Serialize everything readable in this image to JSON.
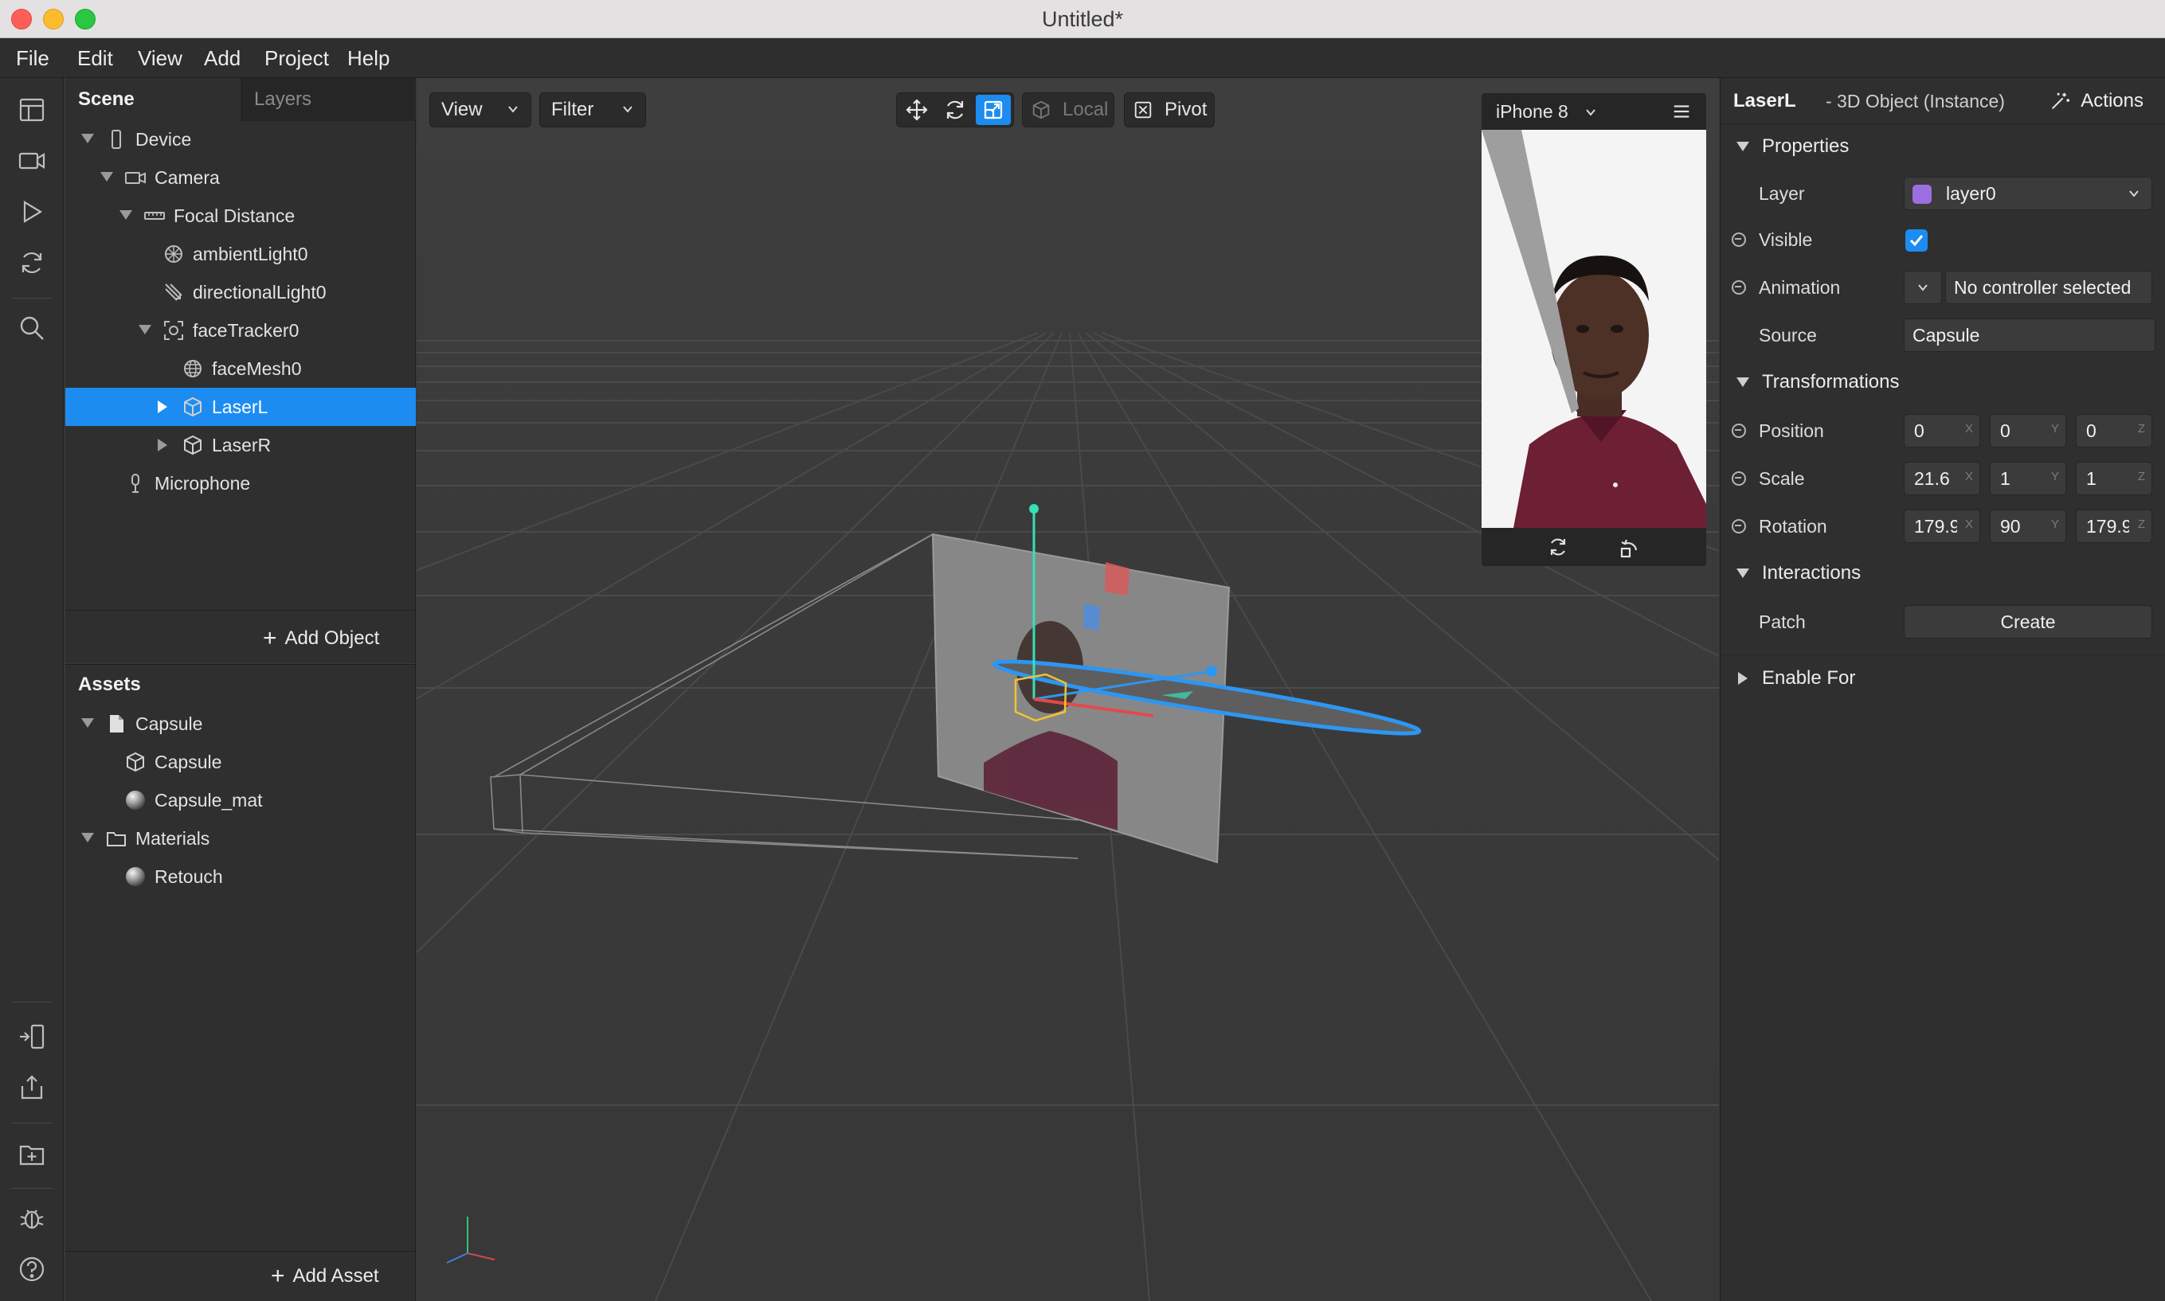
{
  "window": {
    "title": "Untitled*"
  },
  "menu": [
    "File",
    "Edit",
    "View",
    "Add",
    "Project",
    "Help"
  ],
  "scene_panel": {
    "tabs": {
      "scene": "Scene",
      "layers": "Layers"
    },
    "tree": [
      {
        "label": "Device",
        "icon": "phone-icon",
        "depth": 0,
        "expander": "down",
        "selected": false
      },
      {
        "label": "Camera",
        "icon": "camera-icon",
        "depth": 1,
        "expander": "down",
        "selected": false
      },
      {
        "label": "Focal Distance",
        "icon": "ruler-icon",
        "depth": 2,
        "expander": "down",
        "selected": false
      },
      {
        "label": "ambientLight0",
        "icon": "ambient-light-icon",
        "depth": 3,
        "expander": "none",
        "selected": false
      },
      {
        "label": "directionalLight0",
        "icon": "directional-light-icon",
        "depth": 3,
        "expander": "none",
        "selected": false
      },
      {
        "label": "faceTracker0",
        "icon": "face-tracker-icon",
        "depth": 3,
        "expander": "down",
        "selected": false
      },
      {
        "label": "faceMesh0",
        "icon": "mesh-icon",
        "depth": 4,
        "expander": "none",
        "selected": false
      },
      {
        "label": "LaserL",
        "icon": "cube-icon",
        "depth": 4,
        "expander": "right",
        "selected": true
      },
      {
        "label": "LaserR",
        "icon": "cube-icon",
        "depth": 4,
        "expander": "right",
        "selected": false
      },
      {
        "label": "Microphone",
        "icon": "microphone-icon",
        "depth": 1,
        "expander": "none",
        "selected": false
      }
    ],
    "add_object_label": "Add Object"
  },
  "assets_panel": {
    "title": "Assets",
    "tree": [
      {
        "label": "Capsule",
        "icon": "file-icon",
        "depth": 0,
        "expander": "down"
      },
      {
        "label": "Capsule",
        "icon": "cube-icon",
        "depth": 1,
        "expander": "none"
      },
      {
        "label": "Capsule_mat",
        "icon": "material-sphere-icon",
        "depth": 1,
        "expander": "none"
      },
      {
        "label": "Materials",
        "icon": "folder-icon",
        "depth": 0,
        "expander": "down"
      },
      {
        "label": "Retouch",
        "icon": "material-sphere-icon",
        "depth": 1,
        "expander": "none"
      }
    ],
    "add_asset_label": "Add Asset"
  },
  "viewport": {
    "view_label": "View",
    "filter_label": "Filter",
    "local_label": "Local",
    "pivot_label": "Pivot"
  },
  "preview": {
    "device": "iPhone 8"
  },
  "inspector": {
    "object_name": "LaserL",
    "object_type": "- 3D Object (Instance)",
    "actions_label": "Actions",
    "sections": {
      "properties": "Properties",
      "transformations": "Transformations",
      "interactions": "Interactions",
      "enable_for": "Enable For"
    },
    "layer": {
      "label": "Layer",
      "value": "layer0",
      "color": "#9b6fe0"
    },
    "visible": {
      "label": "Visible",
      "checked": true
    },
    "animation": {
      "label": "Animation",
      "value": "No controller selected"
    },
    "source": {
      "label": "Source",
      "value": "Capsule"
    },
    "position": {
      "label": "Position",
      "x": "0",
      "y": "0",
      "z": "0"
    },
    "scale": {
      "label": "Scale",
      "x": "21.6",
      "y": "1",
      "z": "1"
    },
    "rotation": {
      "label": "Rotation",
      "x": "179.9",
      "y": "90",
      "z": "179.9"
    },
    "axes": {
      "x": "X",
      "y": "Y",
      "z": "Z"
    },
    "patch": {
      "label": "Patch",
      "button": "Create"
    }
  },
  "colors": {
    "accent": "#1d8cf1",
    "panel": "#2f2f2f",
    "viewport": "#3a3a3a"
  }
}
